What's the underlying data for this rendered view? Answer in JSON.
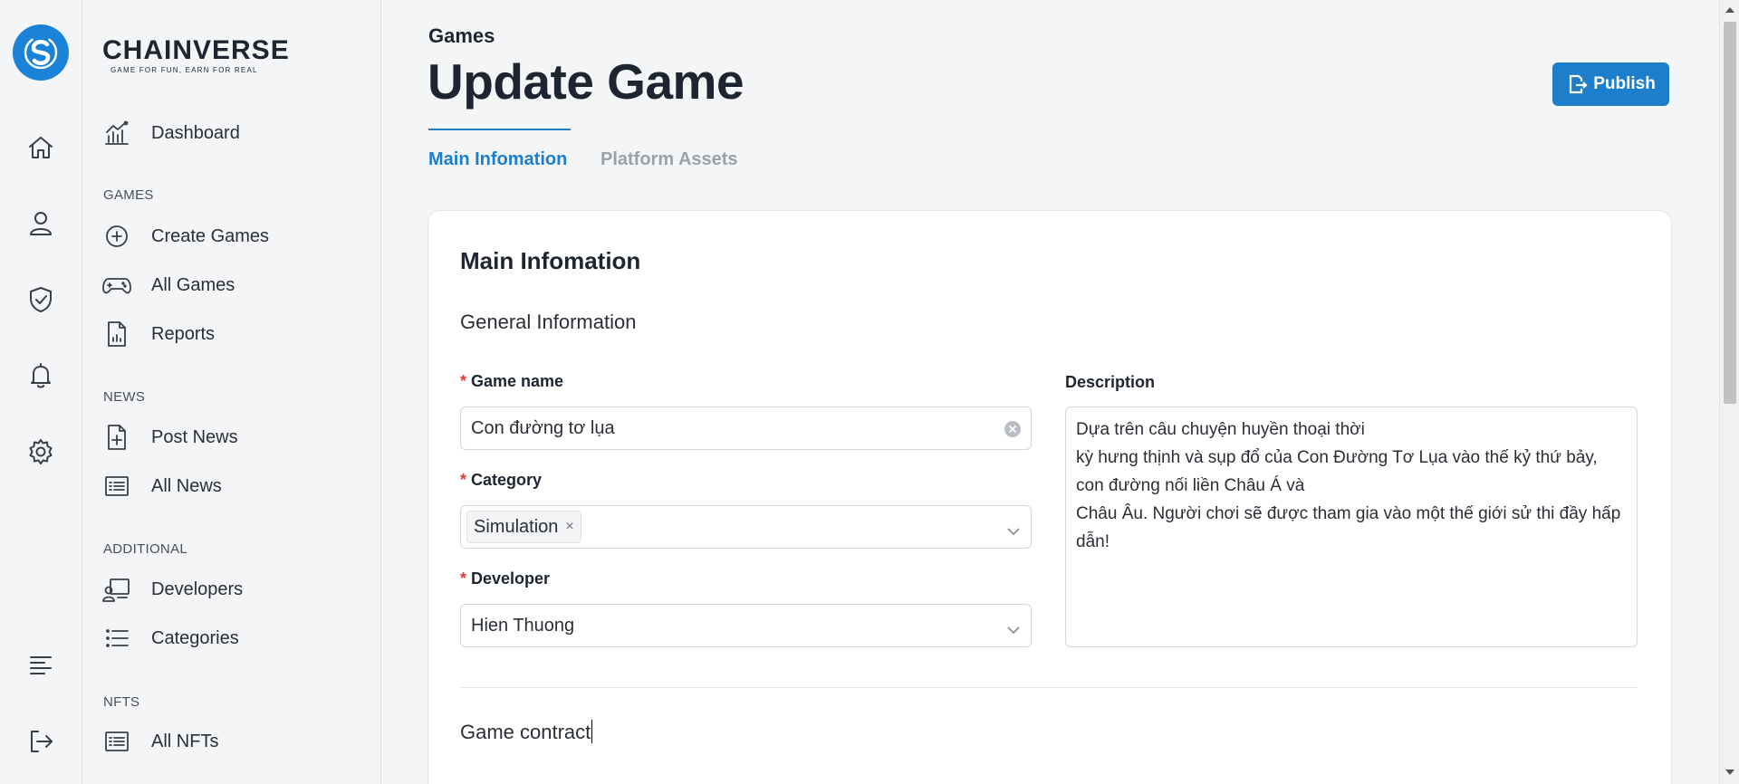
{
  "brand": {
    "name": "CHAINVERSE",
    "tagline": "GAME FOR FUN, EARN FOR REAL"
  },
  "rail": {
    "icons": [
      "home-icon",
      "user-icon",
      "shield-check-icon",
      "bell-icon",
      "gear-icon",
      "menu-lines-icon",
      "logout-icon"
    ]
  },
  "sidebar": {
    "dashboard": "Dashboard",
    "sections": {
      "games": "GAMES",
      "news": "NEWS",
      "additional": "ADDITIONAL",
      "nfts": "NFTS"
    },
    "items": {
      "create_games": "Create Games",
      "all_games": "All Games",
      "reports": "Reports",
      "post_news": "Post News",
      "all_news": "All News",
      "developers": "Developers",
      "categories": "Categories",
      "all_nfts": "All NFTs"
    }
  },
  "header": {
    "breadcrumb": "Games",
    "title": "Update Game",
    "publish_label": "Publish"
  },
  "tabs": {
    "main": "Main Infomation",
    "platform": "Platform Assets"
  },
  "form": {
    "card_title": "Main Infomation",
    "general_title": "General Information",
    "required_mark": "*",
    "game_name_label": "Game name",
    "game_name_value": "Con đường tơ lụa",
    "category_label": "Category",
    "category_tag": "Simulation",
    "category_tag_remove": "×",
    "developer_label": "Developer",
    "developer_value": "Hien Thuong",
    "description_label": "Description",
    "description_value": "Dựa trên câu chuyện huyền thoại thời\nkỳ hưng thịnh và sụp đổ của Con Đường Tơ Lụa vào thế kỷ thứ bảy, con đường nối liền Châu Á và\nChâu Âu. Người chơi sẽ được tham gia vào một thế giới sử thi đầy hấp dẫn!",
    "contract_title": "Game contract"
  },
  "colors": {
    "accent": "#1d7fcb",
    "required": "#e03a3a"
  }
}
